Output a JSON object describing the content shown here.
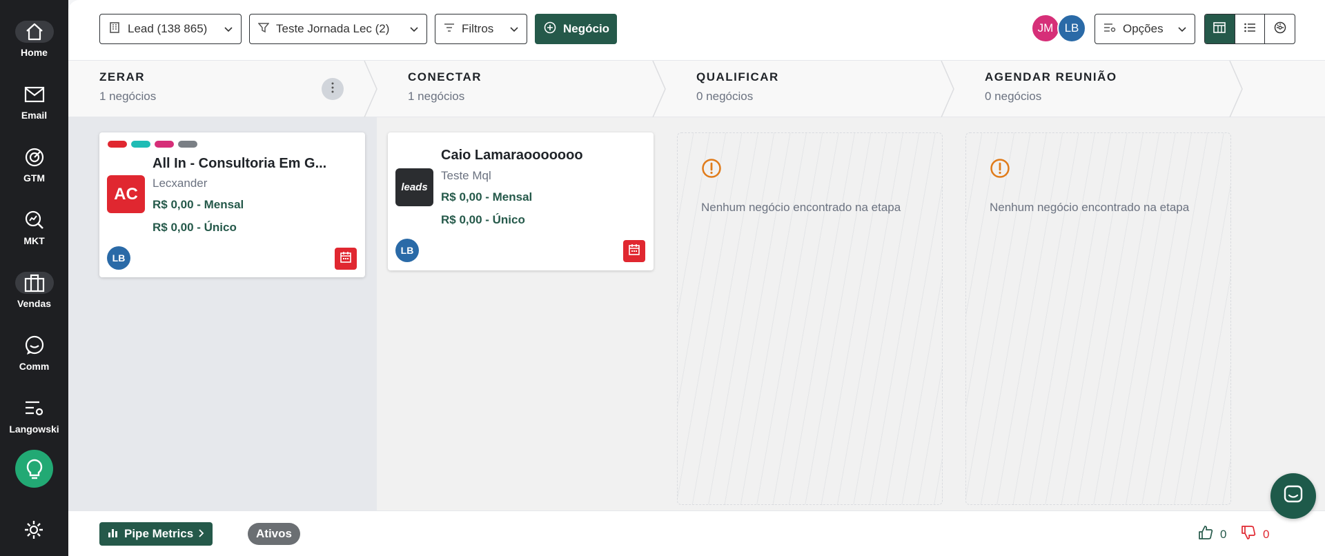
{
  "sidebar": {
    "items": [
      {
        "label": "Home",
        "icon": "home-icon"
      },
      {
        "label": "Email",
        "icon": "mail-icon"
      },
      {
        "label": "GTM",
        "icon": "target-icon"
      },
      {
        "label": "MKT",
        "icon": "search-chart-icon"
      },
      {
        "label": "Vendas",
        "icon": "briefcase-icon"
      },
      {
        "label": "Comm",
        "icon": "chat-bubble-icon"
      },
      {
        "label": "Langowski",
        "icon": "settings-sliders-icon"
      }
    ]
  },
  "toolbar": {
    "lead_label": "Lead (138 865)",
    "journey_label": "Teste Jornada Lec (2)",
    "filters_label": "Filtros",
    "new_deal_label": "Negócio",
    "options_label": "Opções",
    "avatars": [
      {
        "initials": "JM",
        "color": "#d62f78"
      },
      {
        "initials": "LB",
        "color": "#2a6aa7"
      }
    ]
  },
  "stages": [
    {
      "name": "ZERAR",
      "count": "1 negócios"
    },
    {
      "name": "CONECTAR",
      "count": "1 negócios"
    },
    {
      "name": "QUALIFICAR",
      "count": "0 negócios"
    },
    {
      "name": "AGENDAR REUNIÃO",
      "count": "0 negócios"
    }
  ],
  "cards": [
    {
      "title": "All In - Consultoria Em G...",
      "company": "Lecxander",
      "monthly": "R$ 0,00 - Mensal",
      "one_time": "R$ 0,00 - Único",
      "logo_text": "AC",
      "owner": "LB",
      "tags": [
        "#e02730",
        "#1fbcb5",
        "#d62f78",
        "#7a7f85"
      ]
    },
    {
      "title": "Caio Lamaraooooooo",
      "company": "Teste Mql",
      "monthly": "R$ 0,00 - Mensal",
      "one_time": "R$ 0,00 - Único",
      "logo_text": "leads",
      "owner": "LB"
    }
  ],
  "empty_message": "Nenhum negócio encontrado na etapa",
  "bottom": {
    "pipe_metrics_label": "Pipe Metrics",
    "status_label": "Ativos",
    "likes": "0",
    "dislikes": "0"
  },
  "colors": {
    "brand": "#25594a",
    "sidebar": "#1e1f22",
    "danger": "#e02730",
    "warning": "#e07b1a"
  }
}
